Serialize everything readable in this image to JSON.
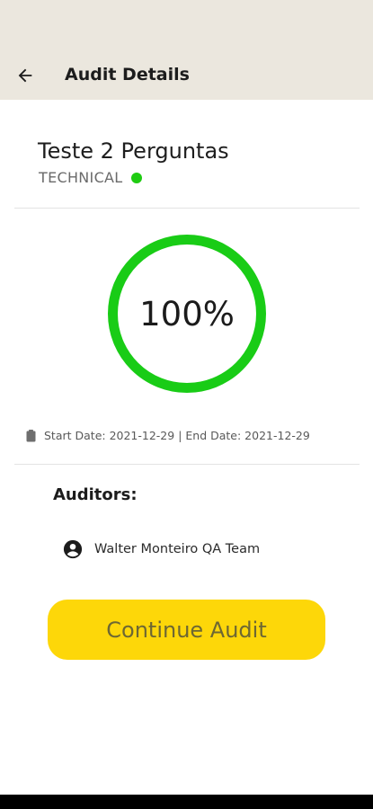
{
  "header": {
    "back_icon": "arrow-left-icon",
    "title": "Audit Details",
    "background": "#ebe7de"
  },
  "audit": {
    "title": "Teste 2 Perguntas",
    "type": "TECHNICAL",
    "status_color": "#1fcc12"
  },
  "progress": {
    "label": "100%",
    "value": 1.0,
    "ring_color": "#19cc16"
  },
  "dates": {
    "icon": "clipboard-icon",
    "text": "Start Date: 2021-12-29 | End Date: 2021-12-29"
  },
  "auditors": {
    "heading": "Auditors:",
    "items": [
      {
        "icon": "account-circle-icon",
        "name": "Walter Monteiro QA Team"
      }
    ]
  },
  "actions": {
    "continue_label": "Continue Audit",
    "button_color": "#fdd709"
  }
}
